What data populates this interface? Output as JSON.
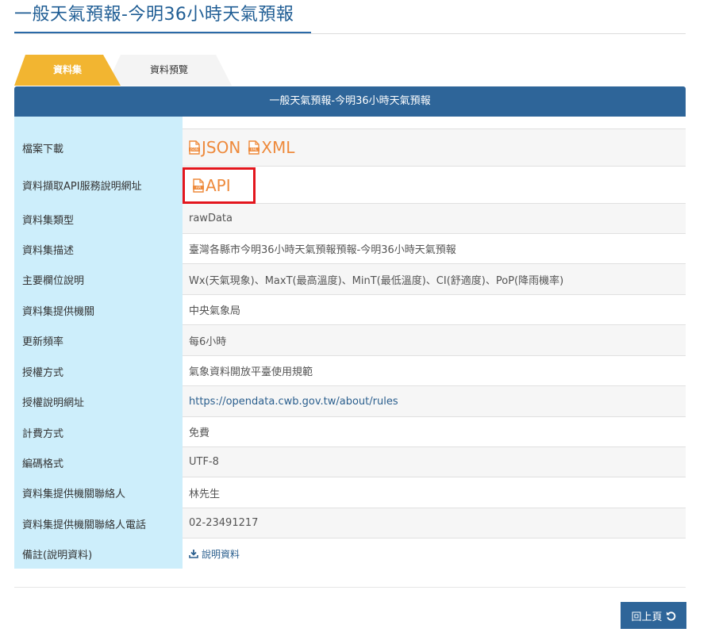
{
  "page": {
    "title": "一般天氣預報-今明36小時天氣預報"
  },
  "tabs": [
    {
      "label": "資料集",
      "active": true
    },
    {
      "label": "資料預覽",
      "active": false
    }
  ],
  "table": {
    "header": "一般天氣預報-今明36小時天氣預報",
    "rows": {
      "download": {
        "label": "檔案下載",
        "json": "JSON",
        "xml": "XML",
        "json_icon_text": "JSON",
        "xml_icon_text": "XML"
      },
      "api": {
        "label": "資料擷取API服務說明網址",
        "value": "API",
        "icon_text": "API"
      },
      "type": {
        "label": "資料集類型",
        "value": "rawData"
      },
      "description": {
        "label": "資料集描述",
        "value": "臺灣各縣市今明36小時天氣預報預報-今明36小時天氣預報"
      },
      "fields": {
        "label": "主要欄位說明",
        "value": "Wx(天氣現象)、MaxT(最高溫度)、MinT(最低溫度)、CI(舒適度)、PoP(降雨機率)"
      },
      "provider": {
        "label": "資料集提供機關",
        "value": "中央氣象局"
      },
      "frequency": {
        "label": "更新頻率",
        "value": "每6小時"
      },
      "license": {
        "label": "授權方式",
        "value": "氣象資料開放平臺使用規範"
      },
      "license_url": {
        "label": "授權說明網址",
        "value": "https://opendata.cwb.gov.tw/about/rules"
      },
      "fee": {
        "label": "計費方式",
        "value": "免費"
      },
      "encoding": {
        "label": "編碼格式",
        "value": "UTF-8"
      },
      "contact": {
        "label": "資料集提供機關聯絡人",
        "value": "林先生"
      },
      "phone": {
        "label": "資料集提供機關聯絡人電話",
        "value": "02-23491217"
      },
      "notes": {
        "label": "備註(說明資料)",
        "value": "說明資料"
      }
    }
  },
  "footer": {
    "back_label": "回上頁"
  },
  "colors": {
    "title": "#1f5d94",
    "header_bg": "#2e6599",
    "tab_active": "#f2b531",
    "label_bg": "#cdeefb",
    "file_link": "#ee8a3c",
    "highlight_box": "#e3161d"
  },
  "icons": {
    "json_file": "json-file-icon",
    "xml_file": "xml-file-icon",
    "api_file": "api-file-icon",
    "download": "download-icon",
    "back": "undo-arrow-icon"
  }
}
